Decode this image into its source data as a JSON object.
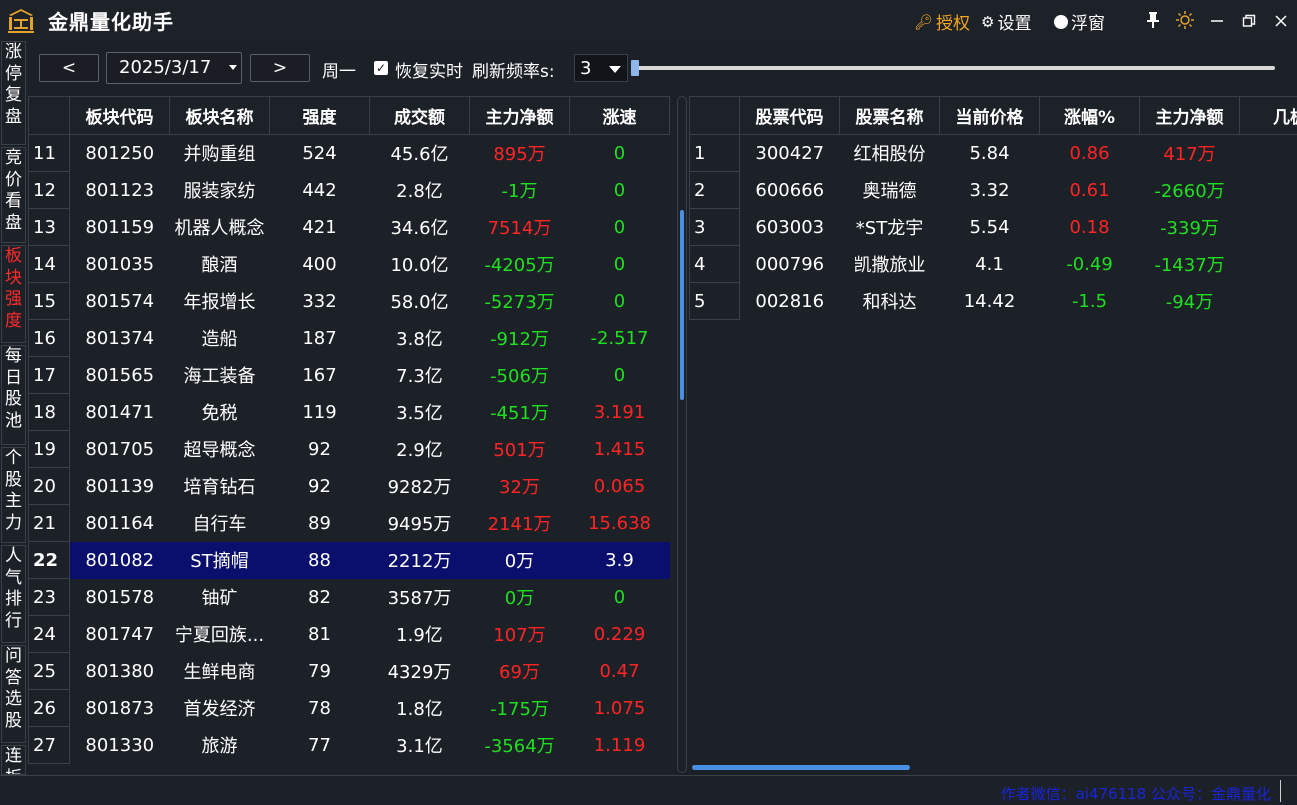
{
  "app": {
    "title": "金鼎量化助手"
  },
  "titlebar": {
    "auth": "授权",
    "settings": "设置",
    "float": "浮窗"
  },
  "sidebar": {
    "items": [
      "涨停复盘",
      "竞价看盘",
      "板块强度",
      "每日股池",
      "个股主力",
      "人气排行",
      "问答选股",
      "连板"
    ],
    "active": 2
  },
  "toolbar": {
    "prev": "<",
    "next": ">",
    "date": "2025/3/17",
    "weekday": "周一",
    "restore": "恢复实时",
    "rate_label": "刷新频率s:",
    "rate": "3"
  },
  "left_table": {
    "headers": [
      "",
      "板块代码",
      "板块名称",
      "强度",
      "成交额",
      "主力净额",
      "涨速"
    ],
    "rows": [
      {
        "n": "11",
        "code": "801250",
        "name": "并购重组",
        "strength": "524",
        "amount": "45.6亿",
        "net": "895万",
        "speed": "0",
        "net_color": "red",
        "speed_color": "green"
      },
      {
        "n": "12",
        "code": "801123",
        "name": "服装家纺",
        "strength": "442",
        "amount": "2.8亿",
        "net": "-1万",
        "speed": "0",
        "net_color": "green",
        "speed_color": "green"
      },
      {
        "n": "13",
        "code": "801159",
        "name": "机器人概念",
        "strength": "421",
        "amount": "34.6亿",
        "net": "7514万",
        "speed": "0",
        "net_color": "red",
        "speed_color": "green"
      },
      {
        "n": "14",
        "code": "801035",
        "name": "酿酒",
        "strength": "400",
        "amount": "10.0亿",
        "net": "-4205万",
        "speed": "0",
        "net_color": "green",
        "speed_color": "green"
      },
      {
        "n": "15",
        "code": "801574",
        "name": "年报增长",
        "strength": "332",
        "amount": "58.0亿",
        "net": "-5273万",
        "speed": "0",
        "net_color": "green",
        "speed_color": "green"
      },
      {
        "n": "16",
        "code": "801374",
        "name": "造船",
        "strength": "187",
        "amount": "3.8亿",
        "net": "-912万",
        "speed": "-2.517",
        "net_color": "green",
        "speed_color": "green"
      },
      {
        "n": "17",
        "code": "801565",
        "name": "海工装备",
        "strength": "167",
        "amount": "7.3亿",
        "net": "-506万",
        "speed": "0",
        "net_color": "green",
        "speed_color": "green"
      },
      {
        "n": "18",
        "code": "801471",
        "name": "免税",
        "strength": "119",
        "amount": "3.5亿",
        "net": "-451万",
        "speed": "3.191",
        "net_color": "green",
        "speed_color": "red"
      },
      {
        "n": "19",
        "code": "801705",
        "name": "超导概念",
        "strength": "92",
        "amount": "2.9亿",
        "net": "501万",
        "speed": "1.415",
        "net_color": "red",
        "speed_color": "red"
      },
      {
        "n": "20",
        "code": "801139",
        "name": "培育钻石",
        "strength": "92",
        "amount": "9282万",
        "net": "32万",
        "speed": "0.065",
        "net_color": "red",
        "speed_color": "red"
      },
      {
        "n": "21",
        "code": "801164",
        "name": "自行车",
        "strength": "89",
        "amount": "9495万",
        "net": "2141万",
        "speed": "15.638",
        "net_color": "red",
        "speed_color": "red"
      },
      {
        "n": "22",
        "code": "801082",
        "name": "ST摘帽",
        "strength": "88",
        "amount": "2212万",
        "net": "0万",
        "speed": "3.9",
        "net_color": "white",
        "speed_color": "white",
        "selected": true
      },
      {
        "n": "23",
        "code": "801578",
        "name": "铀矿",
        "strength": "82",
        "amount": "3587万",
        "net": "0万",
        "speed": "0",
        "net_color": "green",
        "speed_color": "green"
      },
      {
        "n": "24",
        "code": "801747",
        "name": "宁夏回族...",
        "strength": "81",
        "amount": "1.9亿",
        "net": "107万",
        "speed": "0.229",
        "net_color": "red",
        "speed_color": "red"
      },
      {
        "n": "25",
        "code": "801380",
        "name": "生鲜电商",
        "strength": "79",
        "amount": "4329万",
        "net": "69万",
        "speed": "0.47",
        "net_color": "red",
        "speed_color": "red"
      },
      {
        "n": "26",
        "code": "801873",
        "name": "首发经济",
        "strength": "78",
        "amount": "1.8亿",
        "net": "-175万",
        "speed": "1.075",
        "net_color": "green",
        "speed_color": "red"
      },
      {
        "n": "27",
        "code": "801330",
        "name": "旅游",
        "strength": "77",
        "amount": "3.1亿",
        "net": "-3564万",
        "speed": "1.119",
        "net_color": "green",
        "speed_color": "red"
      }
    ]
  },
  "right_table": {
    "headers": [
      "",
      "股票代码",
      "股票名称",
      "当前价格",
      "涨幅%",
      "主力净额",
      "几板"
    ],
    "rows": [
      {
        "n": "1",
        "code": "300427",
        "name": "红相股份",
        "price": "5.84",
        "chg": "0.86",
        "net": "417万",
        "chg_color": "red",
        "net_color": "red"
      },
      {
        "n": "2",
        "code": "600666",
        "name": "奥瑞德",
        "price": "3.32",
        "chg": "0.61",
        "net": "-2660万",
        "chg_color": "red",
        "net_color": "green"
      },
      {
        "n": "3",
        "code": "603003",
        "name": "*ST龙宇",
        "price": "5.54",
        "chg": "0.18",
        "net": "-339万",
        "chg_color": "red",
        "net_color": "green"
      },
      {
        "n": "4",
        "code": "000796",
        "name": "凯撒旅业",
        "price": "4.1",
        "chg": "-0.49",
        "net": "-1437万",
        "chg_color": "green",
        "net_color": "green"
      },
      {
        "n": "5",
        "code": "002816",
        "name": "和科达",
        "price": "14.42",
        "chg": "-1.5",
        "net": "-94万",
        "chg_color": "green",
        "net_color": "green"
      }
    ]
  },
  "status": {
    "author": "作者微信：ai476118 公众号：金鼎量化"
  },
  "colors": {
    "up": "#ff2424",
    "down": "#1fe01f",
    "selected": "#0a0f6e",
    "accent": "#f5a623",
    "link": "#1a24d8"
  }
}
